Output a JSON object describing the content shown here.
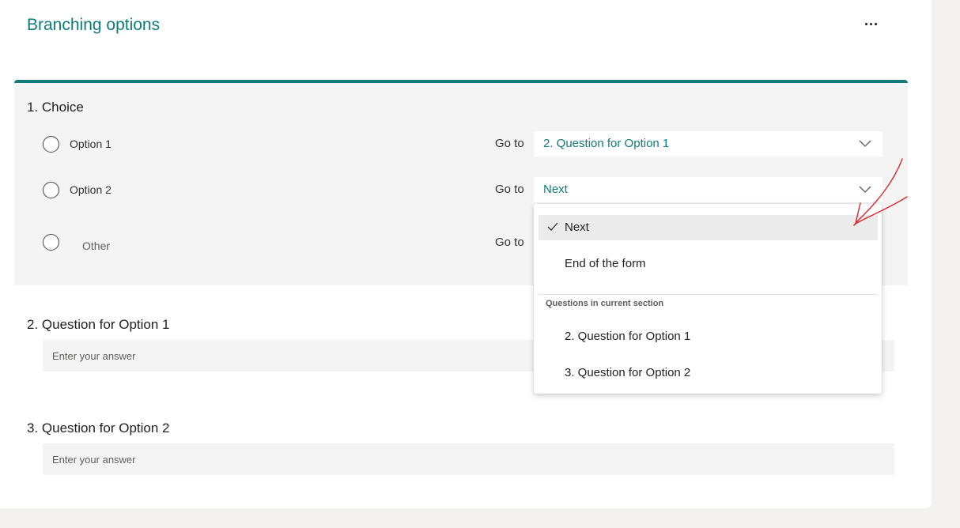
{
  "header": {
    "title": "Branching options",
    "more_icon": "more-horizontal-icon"
  },
  "question1": {
    "title": "1. Choice",
    "goto_label": "Go to",
    "options": [
      {
        "label": "Option 1",
        "goto_value": "2. Question for Option 1"
      },
      {
        "label": "Option 2",
        "goto_value": "Next"
      },
      {
        "label": "Other",
        "goto_value": ""
      }
    ]
  },
  "dropdown": {
    "items": [
      {
        "label": "Next",
        "selected": true
      },
      {
        "label": "End of the form",
        "selected": false
      }
    ],
    "group_header": "Questions in current section",
    "group_items": [
      {
        "label": "2. Question for Option 1"
      },
      {
        "label": "3. Question for Option 2"
      }
    ]
  },
  "question2": {
    "title": "2. Question for Option 1",
    "placeholder": "Enter your answer"
  },
  "question3": {
    "title": "3. Question for Option 2",
    "placeholder": "Enter your answer"
  },
  "colors": {
    "accent": "#0f7b7b",
    "annotation": "#d9262c"
  }
}
